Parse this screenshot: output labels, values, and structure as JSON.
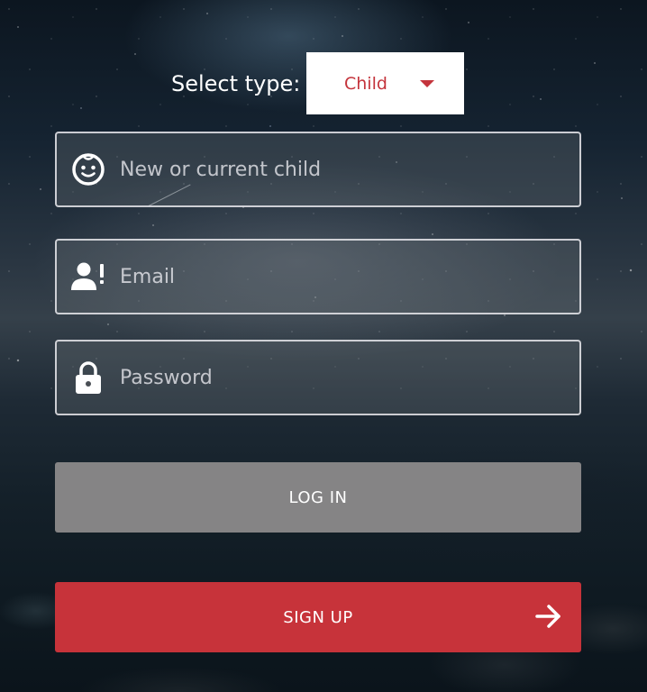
{
  "select_type": {
    "label": "Select type:",
    "selected": "Child"
  },
  "fields": {
    "child": {
      "placeholder": "New or current child",
      "icon": "child-face-icon"
    },
    "email": {
      "placeholder": "Email",
      "icon": "user-alert-icon"
    },
    "password": {
      "placeholder": "Password",
      "icon": "lock-icon"
    }
  },
  "buttons": {
    "login_label": "LOG IN",
    "signup_label": "SIGN UP",
    "signup_icon": "arrow-right-icon"
  },
  "colors": {
    "accent_red": "#c7333a",
    "login_gray": "#858485",
    "select_text": "#c4343c"
  }
}
